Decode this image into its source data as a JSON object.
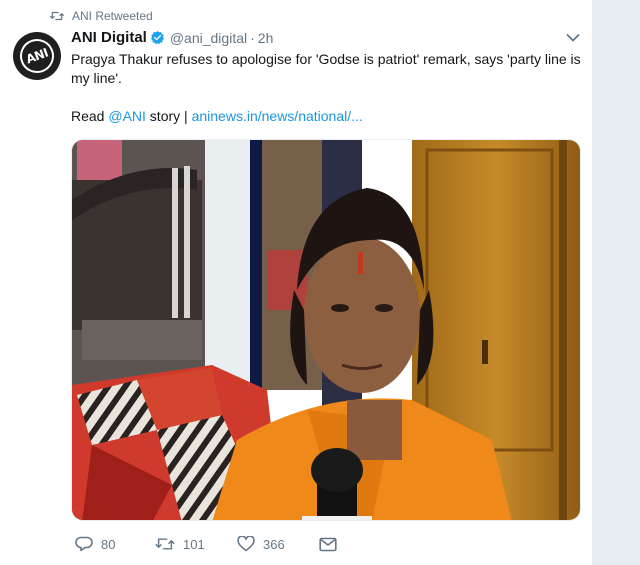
{
  "retweet_notice": "ANI Retweeted",
  "author": {
    "avatar_text": "ANI",
    "name": "ANI Digital",
    "handle": "@ani_digital",
    "separator": "·",
    "time": "2h"
  },
  "tweet": {
    "text": "Pragya Thakur refuses to apologise for 'Godse is patriot' remark, says 'party line is my line'.",
    "read_prefix": "Read ",
    "mention": "@ANI",
    "read_middle": " story | ",
    "link": "aninews.in/news/national/..."
  },
  "media": {
    "kind": "video-thumbnail"
  },
  "actions": {
    "reply_count": "80",
    "retweet_count": "101",
    "like_count": "366"
  },
  "icons": {
    "retweet": "retweet-icon",
    "verified": "verified-badge-icon",
    "caret": "chevron-down-icon",
    "reply": "reply-icon",
    "like": "heart-icon",
    "dm": "envelope-icon"
  },
  "colors": {
    "link": "#1b95e0",
    "secondary_text": "#657786",
    "background": "#e6ecf0"
  }
}
